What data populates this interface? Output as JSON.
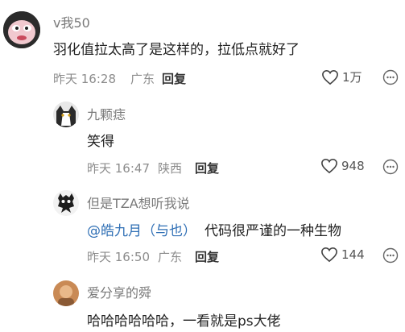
{
  "comments": [
    {
      "username": "v我50",
      "text": "羽化值拉太高了是这样的，拉低点就好了",
      "time": "昨天 16:28",
      "location": "广东",
      "reply_label": "回复",
      "likes": "1万",
      "icons": [
        "heart-icon",
        "more-icon"
      ]
    },
    {
      "username": "九颗痣",
      "text": "笑得",
      "time": "昨天 16:47",
      "location": "陕西",
      "reply_label": "回复",
      "likes": "948",
      "icons": [
        "heart-icon",
        "more-icon"
      ]
    },
    {
      "username": "但是TZA想听我说",
      "mention": "@皓九月（与也）",
      "text": "代码很严谨的一种生物",
      "time": "昨天 16:50",
      "location": "广东",
      "reply_label": "回复",
      "likes": "144",
      "icons": [
        "heart-icon",
        "more-icon"
      ]
    },
    {
      "username": "爱分享的舜",
      "text": "哈哈哈哈哈哈，一看就是ps大佬"
    }
  ],
  "colors": {
    "mention": "#2f6fb5",
    "meta": "#8c8c8c"
  }
}
